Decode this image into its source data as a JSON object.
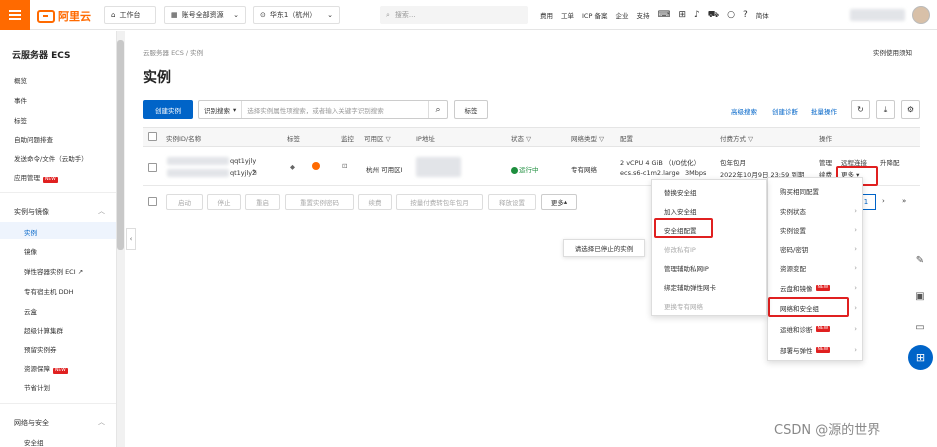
{
  "topbar": {
    "logo_text": "阿里云",
    "workbench": "工作台",
    "account_resources": "账号全部资源",
    "region": "华东1（杭州）",
    "search_placeholder": "搜索...",
    "links": [
      "费用",
      "工单",
      "ICP 备案",
      "企业",
      "支持"
    ],
    "lang": "简体"
  },
  "sidebar": {
    "title": "云服务器 ECS",
    "top_items": [
      "概览",
      "事件",
      "标签",
      "自助问题排查",
      "发送命令/文件（云助手）",
      "应用管理"
    ],
    "group1": "实例与镜像",
    "group1_items": [
      "实例",
      "镜像",
      "弹性容器实例 ECI",
      "专有宿主机 DDH",
      "云盒",
      "超级计算集群",
      "预留实例券",
      "资源保障",
      "节省计划"
    ],
    "group2": "网络与安全",
    "group2_items": [
      "安全组"
    ],
    "new_badge": "NEW"
  },
  "main": {
    "breadcrumb": "云服务器 ECS / 实例",
    "title": "实例",
    "help": "实例使用须知",
    "create_button": "创建实例",
    "search_type": "识别搜索",
    "search_placeholder": "选择实例属性项搜索，或者输入关键字识别搜索",
    "tag_button": "标签",
    "advanced_search": "高级搜索",
    "create_diagnosis": "创建诊断",
    "batch_ops": "批量操作"
  },
  "table": {
    "headers": [
      "实例ID/名称",
      "标签",
      "监控",
      "可用区",
      "IP地址",
      "状态",
      "网络类型",
      "配置",
      "付费方式",
      "操作"
    ],
    "row": {
      "id_suffix_1": "qqt1yjly",
      "id_suffix_2": "qt1yjlyZ",
      "zone": "杭州 可用区I",
      "status": "运行中",
      "network": "专有网络",
      "config_line1": "2 vCPU 4 GiB （I/O优化）",
      "config_line2": "ecs.s6-c1m2.large",
      "bandwidth": "3Mbps",
      "pay_line1": "包年包月",
      "pay_line2": "2022年10月9日 23:59 到期",
      "ops": [
        "管理",
        "远程连接",
        "升降配",
        "续费",
        "更多"
      ]
    }
  },
  "bulk": {
    "buttons": [
      "启动",
      "停止",
      "重启",
      "重置实例密码",
      "续费",
      "按量付费转包年包月",
      "释放设置",
      "更多"
    ],
    "tooltip": "请选择已停止的实例",
    "page_current": "1"
  },
  "more_menu": {
    "items": [
      "购买相同配置",
      "实例状态",
      "实例设置",
      "密码/密钥",
      "资源变配",
      "云盘和镜像",
      "网络和安全组",
      "运维和诊断",
      "部署与弹性"
    ]
  },
  "submenu": {
    "items": [
      "替换安全组",
      "加入安全组",
      "安全组配置",
      "修改私有IP",
      "管理辅助私网IP",
      "绑定辅助弹性网卡",
      "更换专有网络"
    ]
  },
  "watermark": "CSDN @源的世界",
  "colors": {
    "brand": "#ff6a00",
    "primary": "#0064c8",
    "highlight": "#e02020",
    "running": "#1e8e3e"
  }
}
